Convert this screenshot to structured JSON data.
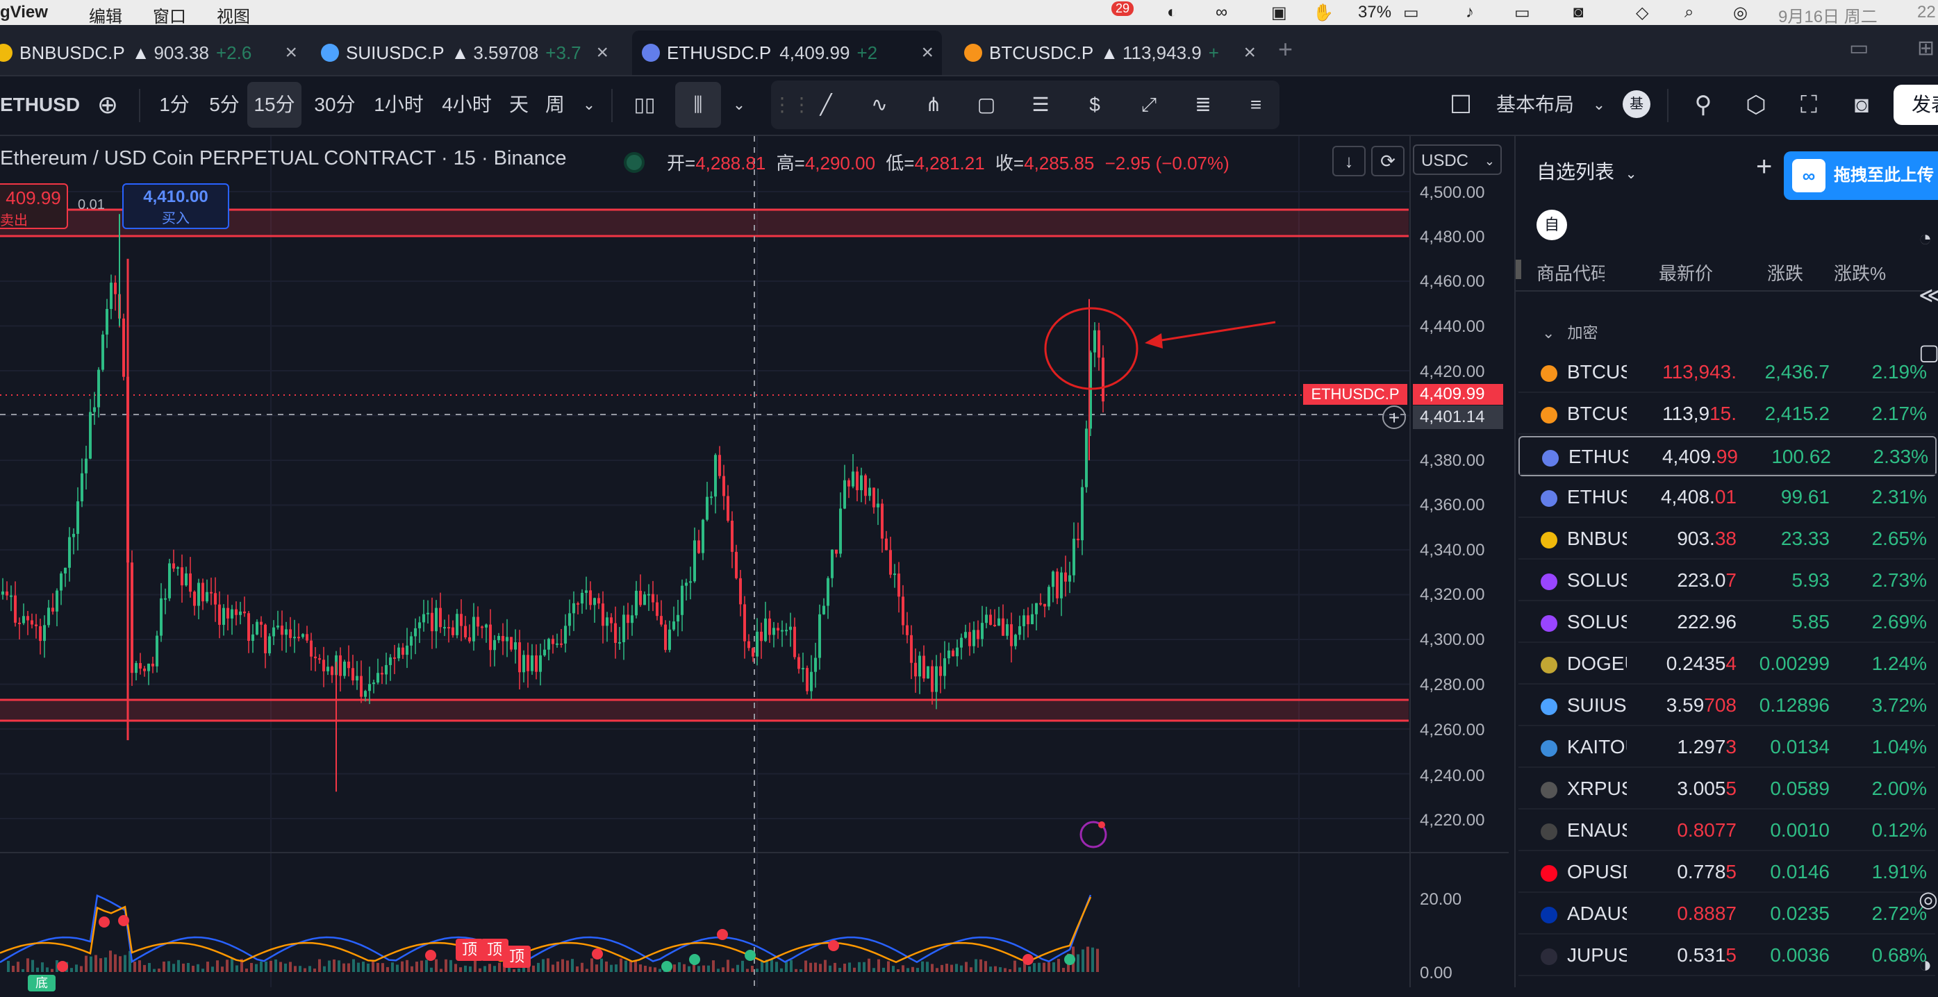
{
  "menubar": {
    "app": "gView",
    "menu_edit": "编辑",
    "menu_window": "窗口",
    "menu_view": "视图",
    "badge": "29",
    "battery": "37%",
    "date": "9月16日 周二",
    "time": "22"
  },
  "tabs": [
    {
      "symbol": "BNBUSDC.P",
      "price": "903.38",
      "change": "+2.6",
      "color": "#f0b90b"
    },
    {
      "symbol": "SUIUSDC.P",
      "price": "3.59708",
      "change": "+3.7",
      "color": "#4da2ff"
    },
    {
      "symbol": "ETHUSDC.P",
      "price": "4,409.99",
      "change": "+2",
      "color": "#627eea"
    },
    {
      "symbol": "BTCUSDC.P",
      "price": "113,943.9",
      "change": "+",
      "color": "#f7931a"
    }
  ],
  "toolbar": {
    "symbol": "ETHUSD",
    "intervals": [
      "1分",
      "5分",
      "15分",
      "30分",
      "1小时",
      "4小时",
      "天",
      "周"
    ],
    "active_interval": "15分",
    "layout": "基本布局",
    "layout_badge": "基",
    "publish": "发表"
  },
  "chart": {
    "title": "Ethereum / USD Coin PERPETUAL CONTRACT · 15 · Binance",
    "open_label": "开=",
    "open": "4,288.81",
    "high_label": "高=",
    "high": "4,290.00",
    "low_label": "低=",
    "low": "4,281.21",
    "close_label": "收=",
    "close": "4,285.85",
    "change": "−2.95 (−0.07%)",
    "currency": "USDC",
    "sell_price": "409.99",
    "sell_label": "卖出",
    "spread": "0.01",
    "buy_price": "4,410.00",
    "buy_label": "买入",
    "price_axis": [
      "4,500.00",
      "4,480.00",
      "4,460.00",
      "4,440.00",
      "4,420.00",
      "4,380.00",
      "4,360.00",
      "4,340.00",
      "4,320.00",
      "4,300.00",
      "4,280.00",
      "4,260.00",
      "4,240.00",
      "4,220.00"
    ],
    "price_tag_symbol": "ETHUSDC.P",
    "last_price": "4,409.99",
    "crosshair_price": "4,401.14",
    "indicator_axis": [
      "20.00",
      "0.00"
    ],
    "signal_top": "顶",
    "signal_bottom": "底",
    "up_color": "#2ebd85",
    "down_color": "#f23645"
  },
  "watchlist": {
    "title": "自选列表",
    "drag_hint": "拖拽至此上传",
    "filter_chip": "自",
    "columns": [
      "商品代码",
      "最新价",
      "涨跌",
      "涨跌%"
    ],
    "group": "加密",
    "rows": [
      {
        "symbol": "BTCUSDC",
        "price_main": "113,943.",
        "price_tail": "",
        "chg": "2,436.7",
        "pct": "2.19%",
        "color": "#f7931a"
      },
      {
        "symbol": "BTCUSDT",
        "price_main": "113,9",
        "price_tail": "15.",
        "chg": "2,415.2",
        "pct": "2.17%",
        "color": "#f7931a"
      },
      {
        "symbol": "ETHUSDC",
        "price_main": "4,409.",
        "price_tail": "99",
        "chg": "100.62",
        "pct": "2.33%",
        "color": "#627eea"
      },
      {
        "symbol": "ETHUSDT",
        "price_main": "4,408.",
        "price_tail": "01",
        "chg": "99.61",
        "pct": "2.31%",
        "color": "#627eea"
      },
      {
        "symbol": "BNBUSDC",
        "price_main": "903.",
        "price_tail": "38",
        "chg": "23.33",
        "pct": "2.65%",
        "color": "#f0b90b"
      },
      {
        "symbol": "SOLUSDC",
        "price_main": "223.0",
        "price_tail": "7",
        "chg": "5.93",
        "pct": "2.73%",
        "color": "#9945ff"
      },
      {
        "symbol": "SOLUSDT",
        "price_main": "222.96",
        "price_tail": "",
        "chg": "5.85",
        "pct": "2.69%",
        "color": "#9945ff"
      },
      {
        "symbol": "DOGEUSDC",
        "price_main": "0.2435",
        "price_tail": "4",
        "chg": "0.00299",
        "pct": "1.24%",
        "color": "#c2a633"
      },
      {
        "symbol": "SUIUSDC",
        "price_main": "3.59",
        "price_tail": "708",
        "chg": "0.12896",
        "pct": "3.72%",
        "color": "#4da2ff"
      },
      {
        "symbol": "KAITOUSDC",
        "price_main": "1.297",
        "price_tail": "3",
        "chg": "0.0134",
        "pct": "1.04%",
        "color": "#3b8bd9"
      },
      {
        "symbol": "XRPUSDC",
        "price_main": "3.005",
        "price_tail": "5",
        "chg": "0.0589",
        "pct": "2.00%",
        "color": "#555555"
      },
      {
        "symbol": "ENAUSDC",
        "price_main": "0.8077",
        "price_tail": "",
        "chg": "0.0010",
        "pct": "0.12%",
        "color": "#444444"
      },
      {
        "symbol": "OPUSDC",
        "price_main": "0.778",
        "price_tail": "5",
        "chg": "0.0146",
        "pct": "1.91%",
        "color": "#ff0420"
      },
      {
        "symbol": "ADAUSDC",
        "price_main": "0.8887",
        "price_tail": "",
        "chg": "0.0235",
        "pct": "2.72%",
        "color": "#0033ad"
      },
      {
        "symbol": "JUPUSDC",
        "price_main": "0.531",
        "price_tail": "5",
        "chg": "0.0036",
        "pct": "0.68%",
        "color": "#2b2b3a"
      }
    ]
  }
}
